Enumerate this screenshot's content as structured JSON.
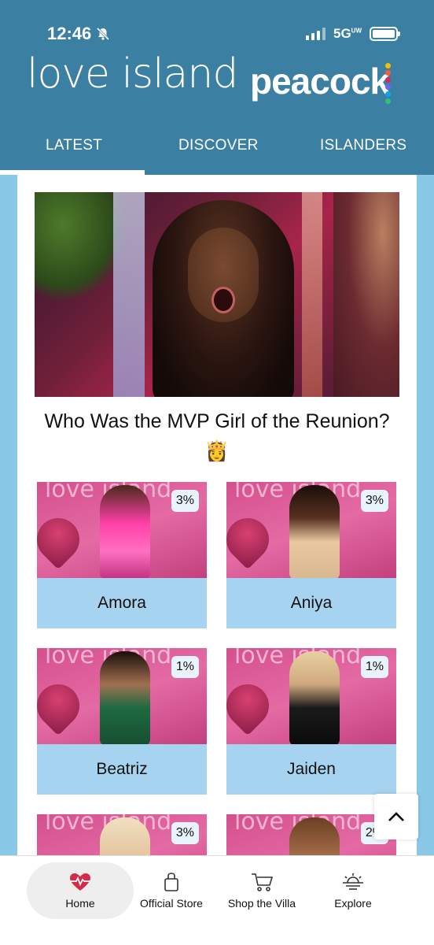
{
  "status_bar": {
    "time": "12:46",
    "network": "5G",
    "network_sub": "UW"
  },
  "header": {
    "brand_logo": "love island",
    "partner_logo": "peacock",
    "tabs": [
      {
        "label": "LATEST",
        "active": true
      },
      {
        "label": "DISCOVER",
        "active": false
      },
      {
        "label": "ISLANDERS",
        "active": false
      }
    ]
  },
  "main": {
    "hero_title": "Who Was the MVP Girl of the Reunion? 👸",
    "candidates": [
      {
        "name": "Amora",
        "percent": "3%"
      },
      {
        "name": "Aniya",
        "percent": "3%"
      },
      {
        "name": "Beatriz",
        "percent": "1%"
      },
      {
        "name": "Jaiden",
        "percent": "1%"
      },
      {
        "name": "",
        "percent": "3%"
      },
      {
        "name": "",
        "percent": "2%"
      }
    ]
  },
  "bottom_nav": {
    "items": [
      {
        "label": "Home",
        "icon": "heartbeat-icon",
        "active": true
      },
      {
        "label": "Official Store",
        "icon": "shopping-bag-icon",
        "active": false
      },
      {
        "label": "Shop the Villa",
        "icon": "shopping-cart-icon",
        "active": false
      },
      {
        "label": "Explore",
        "icon": "sunset-icon",
        "active": false
      }
    ]
  },
  "colors": {
    "header_bg": "#3b80a2",
    "page_bg": "#8ac8e8",
    "name_bar": "#a6d3ef",
    "card_pink": "#d4508e"
  }
}
